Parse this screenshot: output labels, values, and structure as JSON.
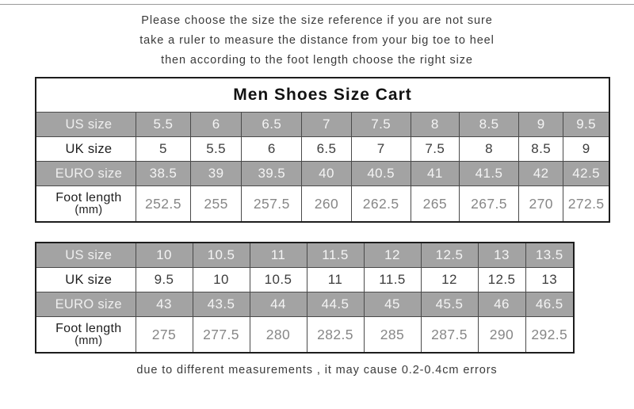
{
  "intro": {
    "lines": [
      "Please choose the size the size reference if  you  are  not  sure",
      "take  a  ruler  to  measure  the  distance  from  your  big  toe  to  heel",
      "then   according   to   the   foot   length   choose   the   right   size"
    ]
  },
  "title": "Men  Shoes  Size  Cart",
  "colors": {
    "shaded_row_bg": "#a3a3a3",
    "shaded_row_text": "#f2f2f2",
    "plain_row_bg": "#ffffff",
    "plain_row_text": "#2b2b2b",
    "foot_length_text": "#878787",
    "border": "#4a4a4a",
    "outer_border": "#1d1d1d"
  },
  "table_one": {
    "row_labels": {
      "us": "US size",
      "uk": "UK size",
      "euro": "EURO size",
      "foot_main": "Foot length",
      "foot_sub": "(mm)"
    },
    "rows": {
      "us": [
        "5.5",
        "6",
        "6.5",
        "7",
        "7.5",
        "8",
        "8.5",
        "9",
        "9.5"
      ],
      "uk": [
        "5",
        "5.5",
        "6",
        "6.5",
        "7",
        "7.5",
        "8",
        "8.5",
        "9"
      ],
      "euro": [
        "38.5",
        "39",
        "39.5",
        "40",
        "40.5",
        "41",
        "41.5",
        "42",
        "42.5"
      ],
      "foot": [
        "252.5",
        "255",
        "257.5",
        "260",
        "262.5",
        "265",
        "267.5",
        "270",
        "272.5"
      ]
    }
  },
  "table_two": {
    "row_labels": {
      "us": "US size",
      "uk": "UK size",
      "euro": "EURO size",
      "foot_main": "Foot length",
      "foot_sub": "(mm)"
    },
    "rows": {
      "us": [
        "10",
        "10.5",
        "11",
        "11.5",
        "12",
        "12.5",
        "13",
        "13.5"
      ],
      "uk": [
        "9.5",
        "10",
        "10.5",
        "11",
        "11.5",
        "12",
        "12.5",
        "13"
      ],
      "euro": [
        "43",
        "43.5",
        "44",
        "44.5",
        "45",
        "45.5",
        "46",
        "46.5"
      ],
      "foot": [
        "275",
        "277.5",
        "280",
        "282.5",
        "285",
        "287.5",
        "290",
        "292.5"
      ]
    }
  },
  "footnote": "due  to  different  measurements , it  may  cause  0.2-0.4cm  errors"
}
